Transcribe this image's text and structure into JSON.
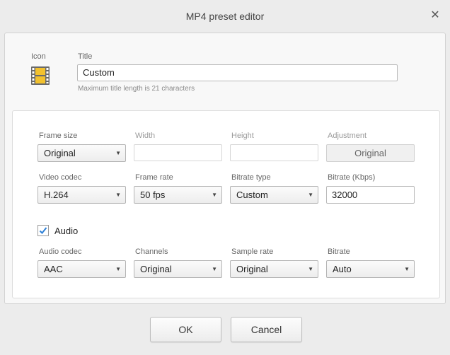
{
  "window": {
    "title": "MP4 preset editor",
    "close_glyph": "✕"
  },
  "header": {
    "icon_label": "Icon",
    "icon_name": "film-icon",
    "title_label": "Title",
    "title_value": "Custom",
    "title_hint": "Maximum title length is 21 characters"
  },
  "video": {
    "frame_size": {
      "label": "Frame size",
      "value": "Original"
    },
    "width": {
      "label": "Width",
      "value": ""
    },
    "height": {
      "label": "Height",
      "value": ""
    },
    "adjustment": {
      "label": "Adjustment",
      "value": "Original"
    },
    "video_codec": {
      "label": "Video codec",
      "value": "H.264"
    },
    "frame_rate": {
      "label": "Frame rate",
      "value": "50 fps"
    },
    "bitrate_type": {
      "label": "Bitrate type",
      "value": "Custom"
    },
    "bitrate": {
      "label": "Bitrate (Kbps)",
      "value": "32000"
    }
  },
  "audio": {
    "enabled_label": "Audio",
    "enabled": true,
    "audio_codec": {
      "label": "Audio codec",
      "value": "AAC"
    },
    "channels": {
      "label": "Channels",
      "value": "Original"
    },
    "sample_rate": {
      "label": "Sample rate",
      "value": "Original"
    },
    "bitrate": {
      "label": "Bitrate",
      "value": "Auto"
    }
  },
  "footer": {
    "ok_label": "OK",
    "cancel_label": "Cancel"
  },
  "colors": {
    "checkmark": "#2c7fd6",
    "film_body": "#f2c12e",
    "film_frame": "#6a6a6a"
  }
}
